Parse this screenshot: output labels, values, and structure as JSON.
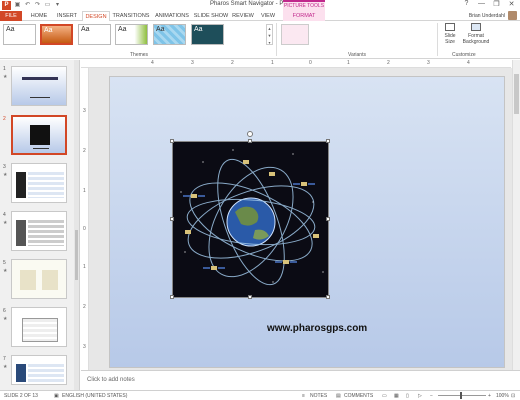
{
  "window": {
    "title": "Pharos Smart Navigator - PowerPoint",
    "context_group": "PICTURE TOOLS",
    "app_logo": "P",
    "controls": [
      "?",
      "—",
      "❐",
      "✕"
    ]
  },
  "tabs": [
    "FILE",
    "HOME",
    "INSERT",
    "DESIGN",
    "TRANSITIONS",
    "ANIMATIONS",
    "SLIDE SHOW",
    "REVIEW",
    "VIEW",
    "FORMAT"
  ],
  "active_tab": "DESIGN",
  "user": {
    "name": "Brian Underdahl"
  },
  "ribbon": {
    "themes_label": "Themes",
    "theme_tiles": [
      "Aa",
      "Aa",
      "Aa",
      "Aa",
      "Aa",
      "Aa"
    ],
    "variants_label": "Variants",
    "customize_label": "Customize",
    "slide_size": "Slide Size",
    "format_background": "Format Background"
  },
  "slides": {
    "numbers": [
      "1",
      "2",
      "3",
      "4",
      "5",
      "6",
      "7"
    ],
    "selected": 2
  },
  "slide": {
    "url_text": "www.pharosgps.com"
  },
  "notes": {
    "placeholder": "Click to add notes"
  },
  "status": {
    "slide_info": "SLIDE 2 OF 13",
    "language": "ENGLISH (UNITED STATES)",
    "notes": "NOTES",
    "comments": "COMMENTS",
    "zoom": "100%"
  },
  "ruler": {
    "h": [
      "4",
      "3",
      "2",
      "1",
      "0",
      "1",
      "2",
      "3",
      "4"
    ],
    "v": [
      "3",
      "2",
      "1",
      "0",
      "1",
      "2",
      "3"
    ]
  },
  "colors": {
    "accent": "#d24726",
    "context": "#c0288c"
  },
  "icons": [
    "save-icon",
    "undo-icon",
    "redo-icon",
    "start-icon",
    "customize-qat-icon",
    "help-icon",
    "minimize-icon",
    "restore-icon",
    "close-icon",
    "slide-size-icon",
    "format-background-icon",
    "notes-icon",
    "comments-icon",
    "normal-view-icon",
    "slide-sorter-icon",
    "reading-view-icon",
    "slideshow-icon"
  ]
}
